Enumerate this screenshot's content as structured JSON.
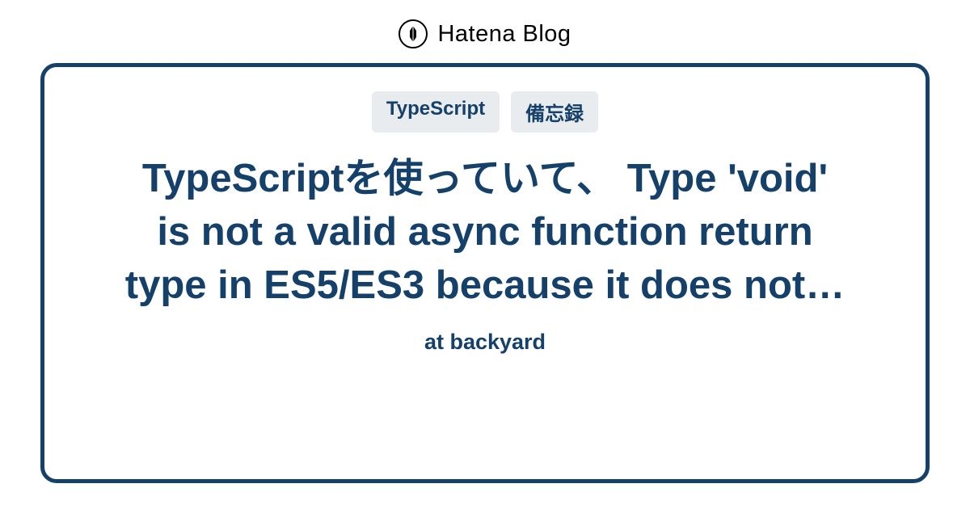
{
  "header": {
    "brand": "Hatena Blog"
  },
  "card": {
    "tags": [
      "TypeScript",
      "備忘録"
    ],
    "title": "TypeScriptを使っていて、 Type 'void' is not a valid async function return type in ES5/ES3 because it does not…",
    "subtitle": "at backyard"
  }
}
